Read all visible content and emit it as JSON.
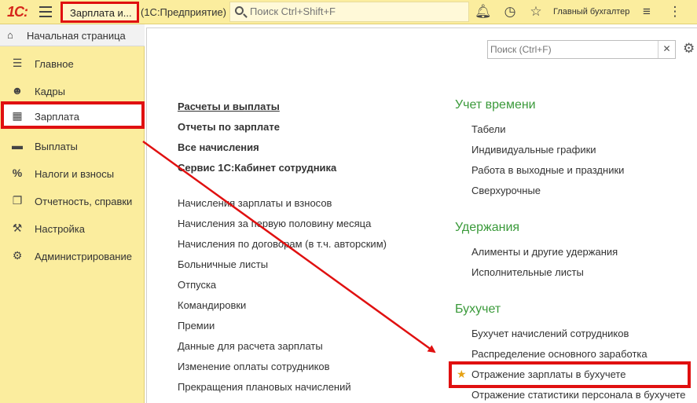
{
  "topbar": {
    "logo": "1С:",
    "title": "Зарплата и...",
    "title_suffix": "(1С:Предприятие)",
    "search_placeholder": "Поиск Ctrl+Shift+F",
    "user": "Главный бухгалтер"
  },
  "sidebar": {
    "home": "Начальная страница",
    "items": [
      {
        "label": "Главное",
        "icon": "menu-lines-icon"
      },
      {
        "label": "Кадры",
        "icon": "people-icon"
      },
      {
        "label": "Зарплата",
        "icon": "calculator-icon",
        "active": true
      },
      {
        "label": "Выплаты",
        "icon": "card-icon"
      },
      {
        "label": "Налоги и взносы",
        "icon": "percent-icon"
      },
      {
        "label": "Отчетность, справки",
        "icon": "documents-icon"
      },
      {
        "label": "Настройка",
        "icon": "wrench-icon"
      },
      {
        "label": "Администрирование",
        "icon": "gear-icon"
      }
    ]
  },
  "main": {
    "search_placeholder": "Поиск (Ctrl+F)",
    "left_bold": [
      "Расчеты и выплаты",
      "Отчеты по зарплате",
      "Все начисления",
      "Сервис 1С:Кабинет сотрудника"
    ],
    "left_links": [
      "Начисления зарплаты и взносов",
      "Начисления за первую половину месяца",
      "Начисления по договорам (в т.ч. авторским)",
      "Больничные листы",
      "Отпуска",
      "Командировки",
      "Премии",
      "Данные для расчета зарплаты",
      "Изменение оплаты сотрудников",
      "Прекращения плановых начислений"
    ],
    "sections": [
      {
        "title": "Учет времени",
        "links": [
          "Табели",
          "Индивидуальные графики",
          "Работа в выходные и праздники",
          "Сверхурочные"
        ]
      },
      {
        "title": "Удержания",
        "links": [
          "Алименты и другие удержания",
          "Исполнительные листы"
        ]
      },
      {
        "title": "Бухучет",
        "links": [
          "Бухучет начислений сотрудников",
          "Распределение основного заработка",
          "Отражение зарплаты в бухучете",
          "Отражение статистики персонала в бухучете"
        ]
      }
    ]
  },
  "colors": {
    "accent_yellow": "#fbed9e",
    "highlight_red": "#e01010",
    "section_green": "#3a9a3a"
  }
}
